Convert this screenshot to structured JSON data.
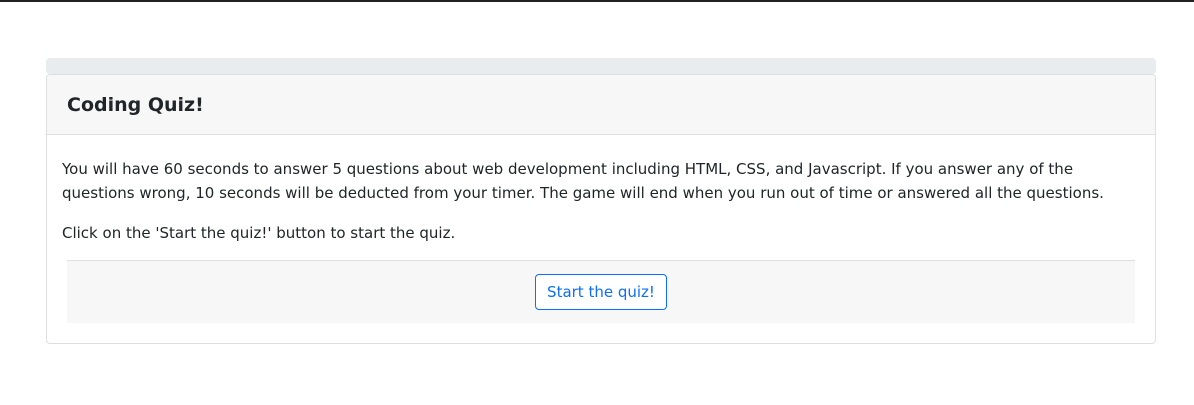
{
  "progress": {
    "percent": 0,
    "fill_color": "#0d6efd"
  },
  "card": {
    "title": "Coding Quiz!",
    "intro_text": "You will have 60 seconds to answer 5 questions about web development including HTML, CSS, and Javascript. If you answer any of the questions wrong, 10 seconds will be deducted from your timer. The game will end when you run out of time or answered all the questions.",
    "instruction_text": "Click on the 'Start the quiz!' button to start the quiz.",
    "start_button_label": "Start the quiz!"
  },
  "colors": {
    "accent": "#0d6efd",
    "header_bg": "#f7f7f7",
    "track_bg": "#e9ecef"
  }
}
